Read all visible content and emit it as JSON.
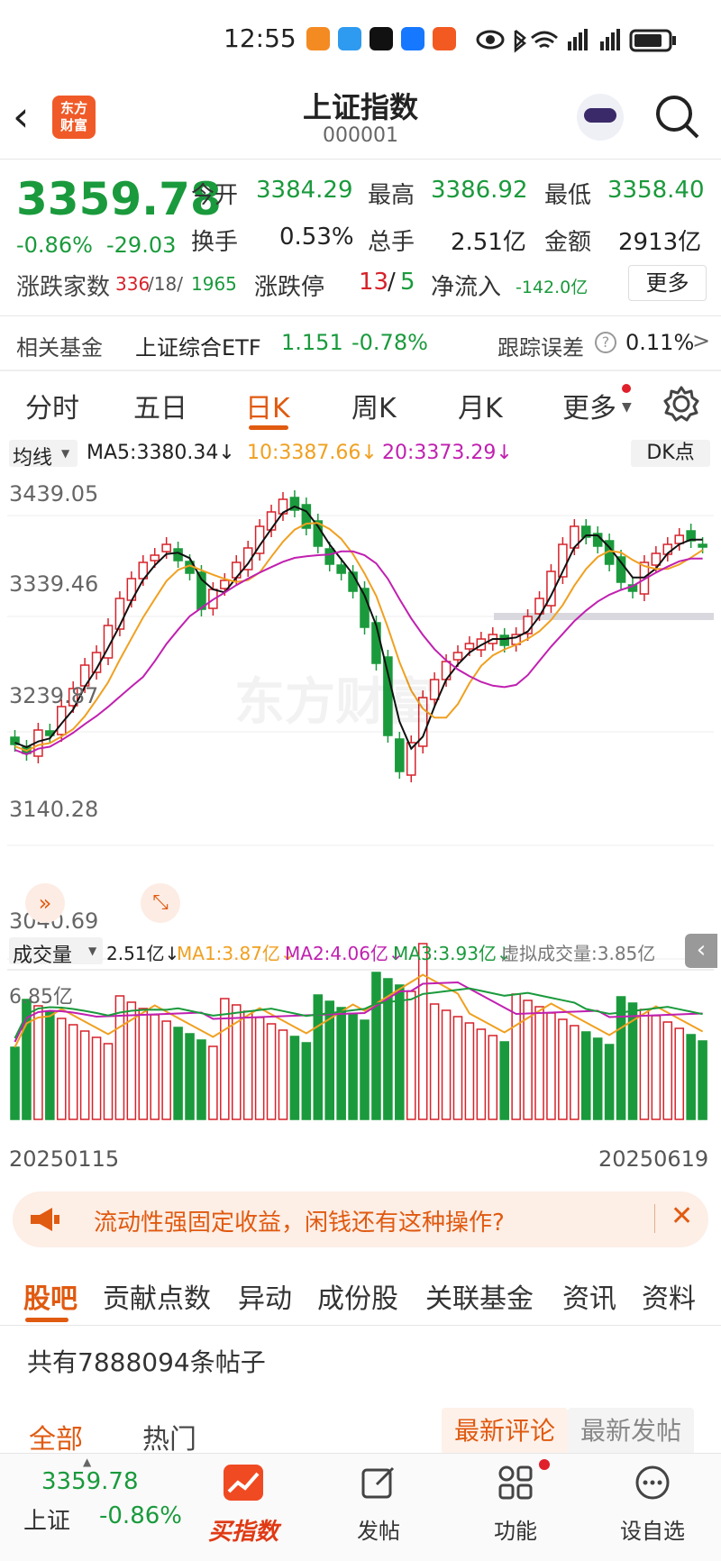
{
  "status": {
    "time": "12:55"
  },
  "header": {
    "title": "上证指数",
    "code": "000001",
    "logo": "东方\n财富"
  },
  "quote": {
    "price": "3359.78",
    "pct": "-0.86%",
    "chg": "-29.03",
    "open_label": "今开",
    "open": "3384.29",
    "high_label": "最高",
    "high": "3386.92",
    "low_label": "最低",
    "low": "3358.40",
    "turnover_label": "换手",
    "turnover": "0.53%",
    "volume_label": "总手",
    "volume": "2.51亿",
    "amount_label": "金额",
    "amount": "2913亿",
    "breadth_label": "涨跌家数",
    "breadth_up": "336",
    "breadth_flat": "/18/",
    "breadth_down": "1965",
    "limit_label": "涨跌停",
    "limit_up": "13",
    "limit_sep": "/",
    "limit_down": "5",
    "inflow_label": "净流入",
    "inflow": "-142.0亿",
    "more": "更多"
  },
  "fund": {
    "label": "相关基金",
    "name": "上证综合ETF",
    "price": "1.151",
    "pct": "-0.78%",
    "err_label": "跟踪误差",
    "err": "0.11%",
    "arrow": ">"
  },
  "tabs": [
    "分时",
    "五日",
    "日K",
    "周K",
    "月K",
    "更多"
  ],
  "ma": {
    "label": "均线",
    "ma5": "MA5:3380.34↓",
    "ma10": "10:3387.66↓",
    "ma20": "20:3373.29↓",
    "dk": "DK点"
  },
  "yaxis": [
    "3439.05",
    "3339.46",
    "3239.87",
    "3140.28",
    "3040.69"
  ],
  "volbar": {
    "label": "成交量",
    "v": "2.51亿↓",
    "ma1": "MA1:3.87亿↓",
    "ma2": "MA2:4.06亿↓",
    "ma3": "MA3:3.93亿↓",
    "virtual": "虚拟成交量:3.85亿",
    "max": "6.85亿"
  },
  "dates": {
    "start": "20250115",
    "end": "20250619"
  },
  "watermark": "东方财富",
  "ad": {
    "text": "流动性强固定收益，闲钱还有这种操作?"
  },
  "section_tabs": [
    "股吧",
    "贡献点数",
    "异动",
    "成份股",
    "关联基金",
    "资讯",
    "资料"
  ],
  "posts": {
    "count": "共有7888094条帖子",
    "all": "全部",
    "hot": "热门",
    "latest_comment": "最新评论",
    "latest_post": "最新发帖"
  },
  "bottom": {
    "price": "3359.78",
    "name": "上证",
    "pct": "-0.86%",
    "buy": "买指数",
    "post": "发帖",
    "func": "功能",
    "watch": "设自选"
  },
  "colors": {
    "up": "#d6222a",
    "down": "#1a9a3c",
    "accent": "#e05a10",
    "ma10": "#f0a020",
    "ma20": "#c020b0"
  }
}
